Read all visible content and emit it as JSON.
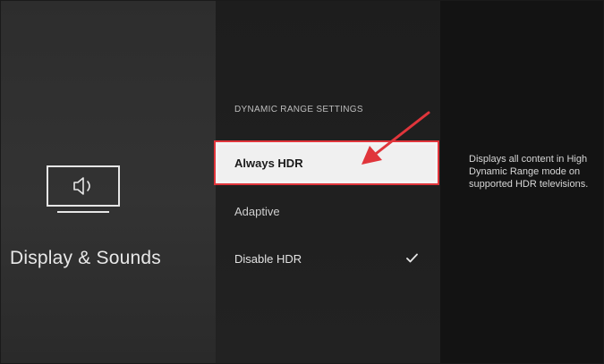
{
  "sidebar": {
    "icon": "tv-speaker-icon",
    "title": "Display & Sounds"
  },
  "settings": {
    "heading": "DYNAMIC RANGE SETTINGS",
    "options": [
      {
        "label": "Always HDR",
        "focused": true,
        "selected": false
      },
      {
        "label": "Adaptive",
        "focused": false,
        "selected": false
      },
      {
        "label": "Disable HDR",
        "focused": false,
        "selected": true
      }
    ]
  },
  "detail": {
    "description": "Displays all content in High Dynamic Range mode on supported HDR televisions."
  },
  "annotation": {
    "highlight_color": "#e0353b",
    "arrow_icon": "red-arrow-icon"
  }
}
